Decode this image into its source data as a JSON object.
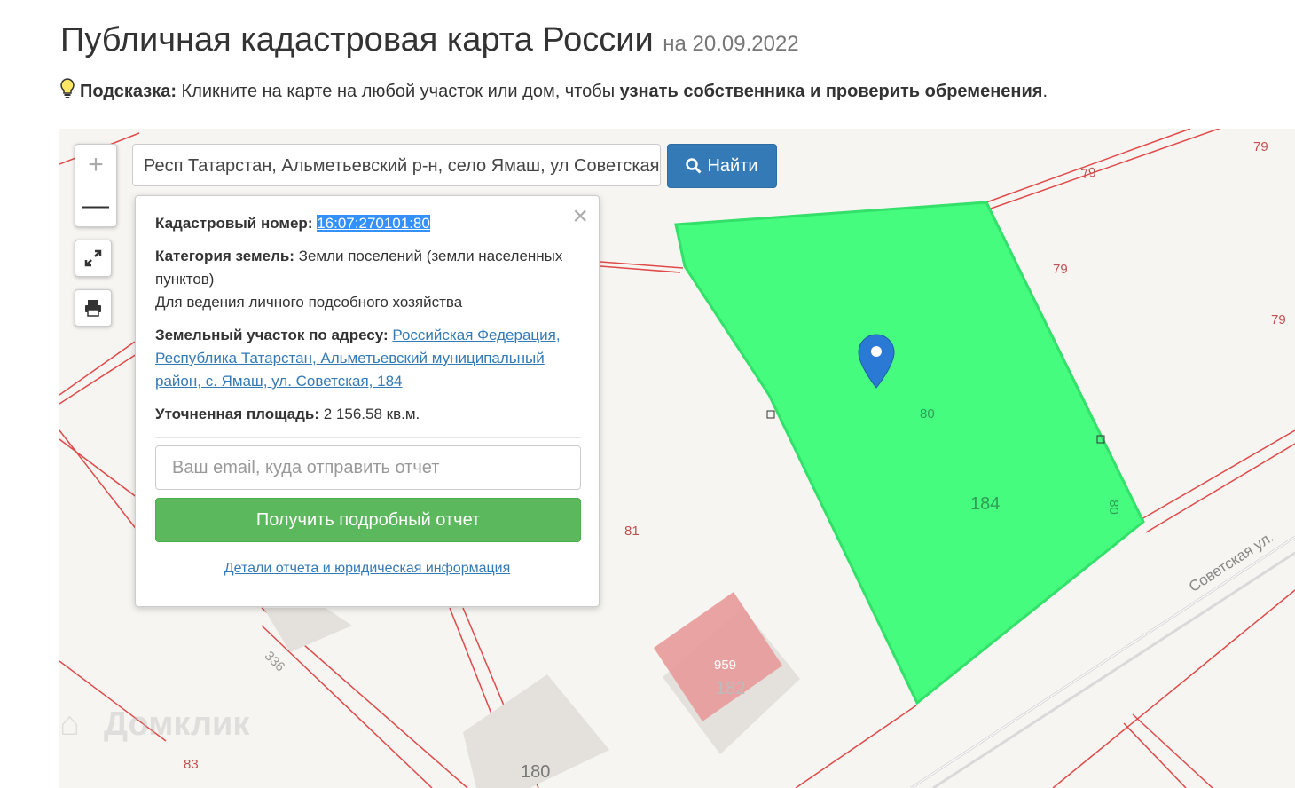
{
  "header": {
    "title": "Публичная кадастровая карта России",
    "date": "на 20.09.2022"
  },
  "hint": {
    "label": "Подсказка:",
    "text": " Кликните на карте на любой участок или дом, чтобы ",
    "bold": "узнать собственника и проверить обременения",
    "end": "."
  },
  "search": {
    "value": "Респ Татарстан, Альметьевский р-н, село Ямаш, ул Советская",
    "button_label": "Найти"
  },
  "controls": {
    "zoom_in": "+",
    "zoom_out": "—"
  },
  "popup": {
    "cadastral_label": "Кадастровый номер:",
    "cadastral_number": "16:07:270101:80",
    "category_label": "Категория земель:",
    "category_value": "Земли поселений (земли населенных пунктов)",
    "usage": "Для ведения личного подсобного хозяйства",
    "address_label": "Земельный участок по адресу:",
    "address_value": "Российская Федерация, Республика Татарстан, Альметьевский муниципальный район, с. Ямаш, ул. Советская, 184",
    "area_label": "Уточненная площадь:",
    "area_value": "2 156.58 кв.м.",
    "email_placeholder": "Ваш email, куда отправить отчет",
    "report_button": "Получить подробный отчет",
    "details_link": "Детали отчета и юридическая информация",
    "close": "×"
  },
  "map": {
    "labels": [
      "79",
      "79",
      "79",
      "79",
      "81",
      "83",
      "336",
      "180",
      "182",
      "959",
      "80",
      "80",
      "184"
    ],
    "street": "Советская ул.",
    "watermark": "Домклик",
    "colors": {
      "parcel_fill": "#46fc7f",
      "parcel_border": "#32e06a",
      "boundary": "#e04a4a",
      "building": "#e89a9a",
      "marker": "#2a7ad5"
    }
  }
}
